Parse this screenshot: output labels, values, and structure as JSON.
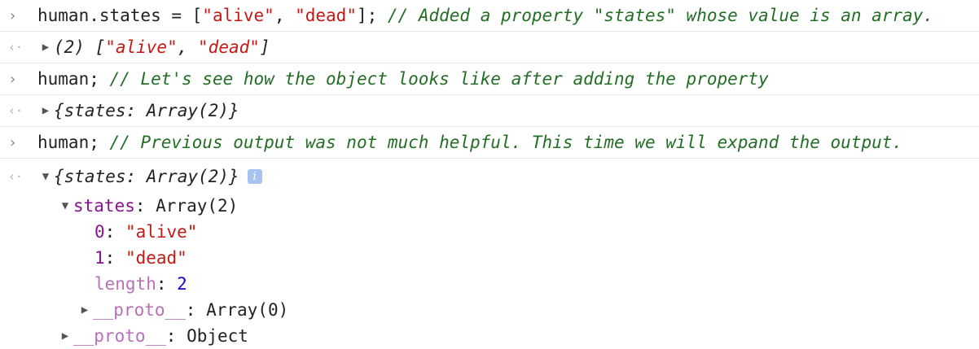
{
  "lines": [
    {
      "kind": "input",
      "code": "human.states = [",
      "str1": "\"alive\"",
      "sep": ", ",
      "str2": "\"dead\"",
      "end": "]; ",
      "comment": "// Added a property \"states\" whose value is an array."
    },
    {
      "kind": "output",
      "prefix": "(2) [",
      "str1": "\"alive\"",
      "sep": ", ",
      "str2": "\"dead\"",
      "end": "]"
    },
    {
      "kind": "input",
      "code": "human; ",
      "comment": "// Let's see how the object looks like after adding the property"
    },
    {
      "kind": "output",
      "text": "{states: Array(2)}"
    },
    {
      "kind": "input",
      "code": "human; ",
      "comment": "// Previous output was not much helpful. This time we will expand the output."
    },
    {
      "kind": "output",
      "text": "{states: Array(2)}",
      "badge": "i"
    }
  ],
  "tree": {
    "states_key": "states",
    "states_val": ": Array(2)",
    "items": [
      {
        "key": "0",
        "val": "\"alive\""
      },
      {
        "key": "1",
        "val": "\"dead\""
      }
    ],
    "length_key": "length",
    "length_val": "2",
    "proto_inner_key": "__proto__",
    "proto_inner_val": ": Array(0)",
    "proto_outer_key": "__proto__",
    "proto_outer_val": ": Object"
  },
  "icons": {
    "prompt": "chevron-right-icon",
    "result": "return-arrow-icon",
    "collapsed": "triangle-right-icon",
    "expanded": "triangle-down-icon",
    "info": "info-icon"
  },
  "colors": {
    "string": "#c41a16",
    "comment": "#236e25",
    "key": "#881391",
    "number": "#1c00cf"
  }
}
